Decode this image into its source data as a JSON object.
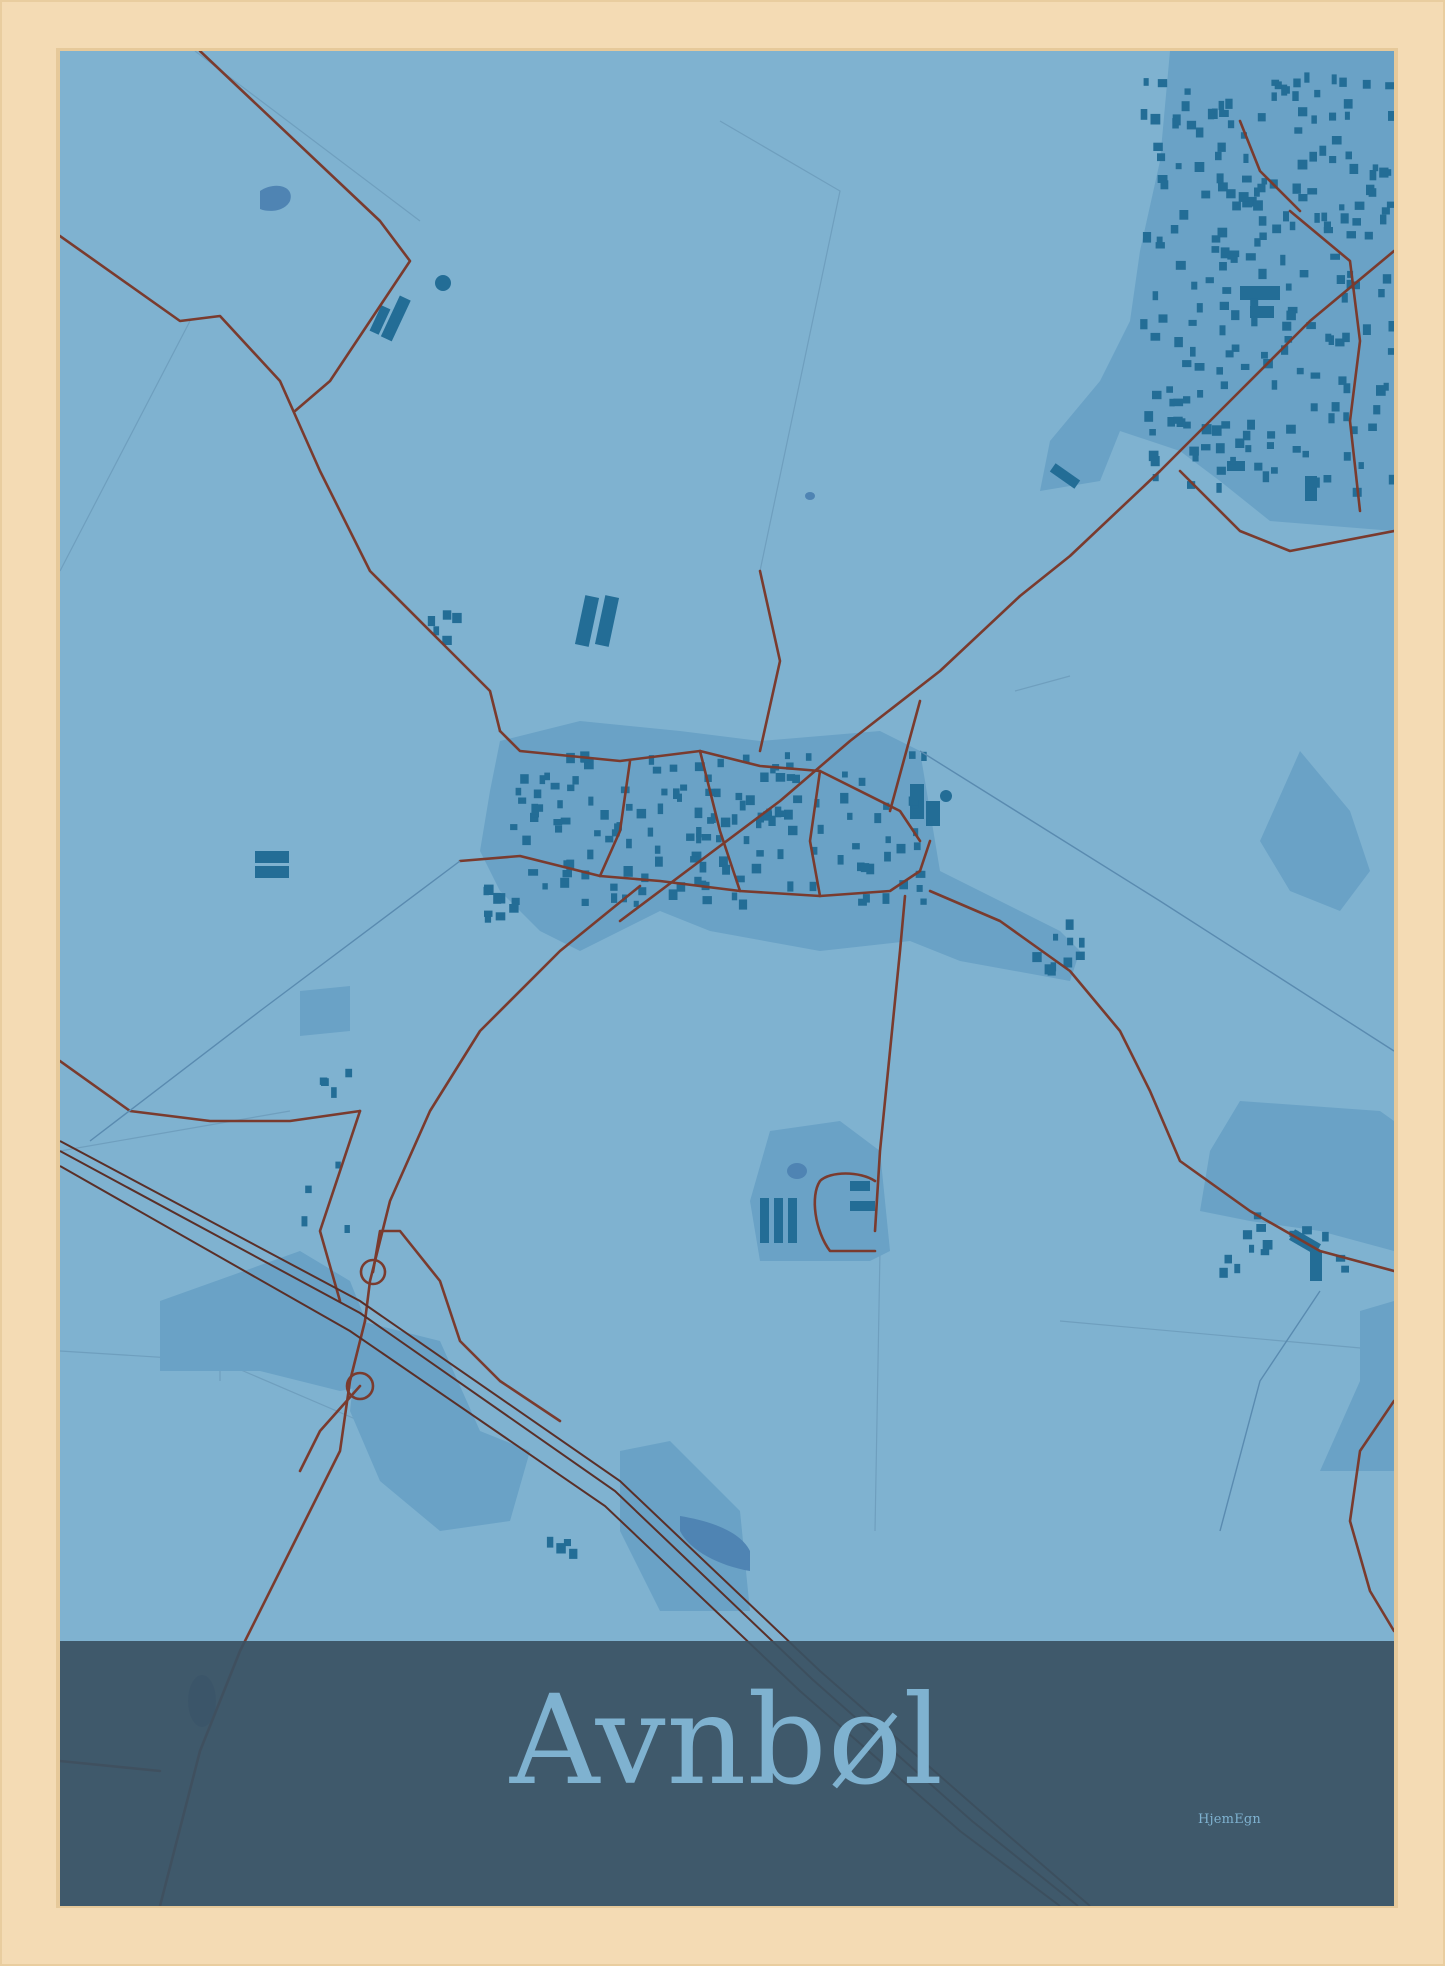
{
  "poster": {
    "title": "Avnbøl",
    "brand": "HjemEgn"
  },
  "colors": {
    "frame": "#f4dbb4",
    "land": "#7fb2d0",
    "built_area": "#6aa2c6",
    "buildings": "#236d96",
    "roads": "#7a3b2e",
    "water": "#4f84b3",
    "title_band": "#3a5263",
    "title_text": "#7fb2d0"
  },
  "icons": {
    "map": "map-graphic",
    "frame": "wooden-frame"
  }
}
